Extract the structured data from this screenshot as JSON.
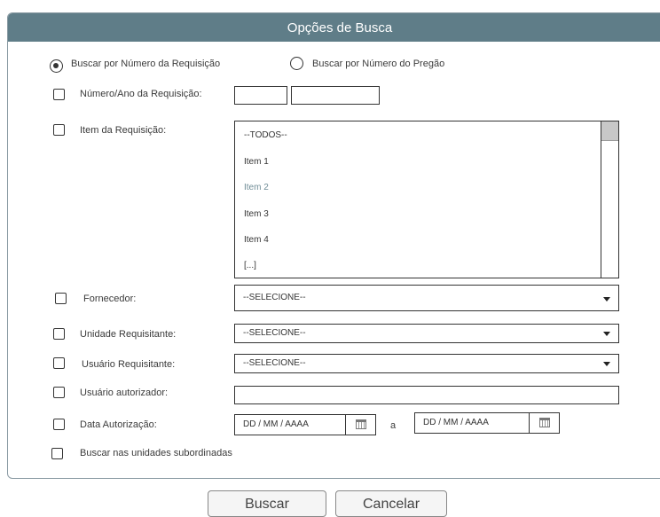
{
  "panel": {
    "title": "Opções de Busca"
  },
  "search_mode": {
    "option_requisicao": "Buscar por Número da Requisição",
    "option_pregao": "Buscar por Número do Pregão"
  },
  "fields": {
    "numero_ano": {
      "label": "Número/Ano da Requisição:"
    },
    "item": {
      "label": "Item da Requisição:",
      "options": [
        "--TODOS--",
        "Item 1",
        "Item 2",
        "Item 3",
        "Item 4",
        "[...]"
      ],
      "selected": "Item 2"
    },
    "fornecedor": {
      "label": "Fornecedor:",
      "value": "--SELECIONE--"
    },
    "unidade": {
      "label": "Unidade Requisitante:",
      "value": "--SELECIONE--"
    },
    "usuario_req": {
      "label": "Usuário Requisitante:",
      "value": "--SELECIONE--"
    },
    "usuario_aut": {
      "label": "Usuário autorizador:"
    },
    "data": {
      "label": "Data Autorização:",
      "from_placeholder": "DD / MM / AAAA",
      "separator": "a",
      "to_placeholder": "DD / MM / AAAA"
    },
    "subordinadas": {
      "label": "Buscar nas unidades subordinadas"
    }
  },
  "buttons": {
    "search": "Buscar",
    "cancel": "Cancelar"
  },
  "colors": {
    "header": "#5f7d88",
    "selected_item": "#6f8c96"
  }
}
